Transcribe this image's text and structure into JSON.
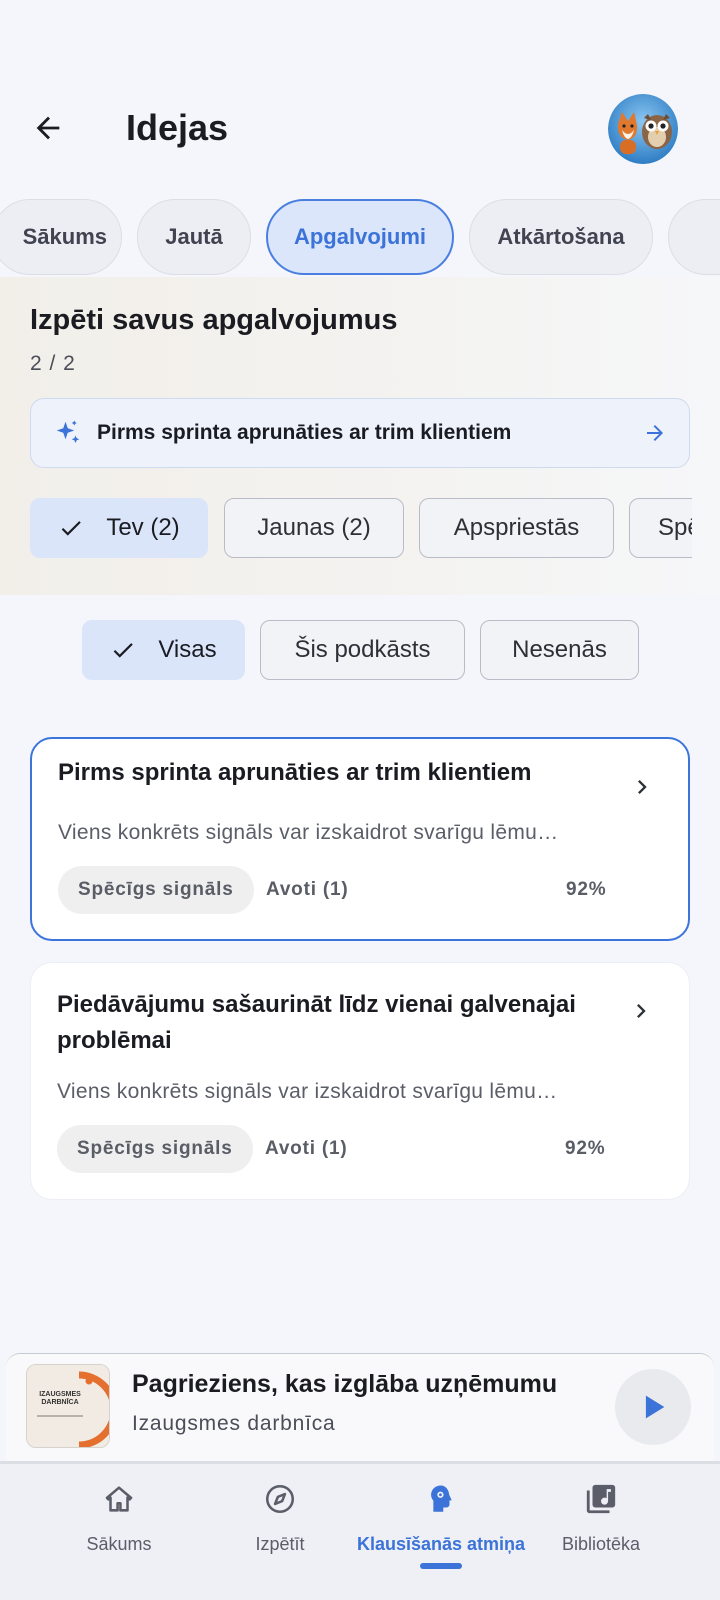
{
  "header": {
    "title": "Idejas"
  },
  "tabs": [
    {
      "label": "Sākums"
    },
    {
      "label": "Jautā"
    },
    {
      "label": "Apgalvojumi"
    },
    {
      "label": "Atkārtošana"
    }
  ],
  "section": {
    "title": "Izpēti savus apgalvojumus",
    "counter": "2 / 2"
  },
  "suggestion": {
    "text": "Pirms sprinta aprunāties ar trim klientiem"
  },
  "filters": [
    {
      "label": "Tev (2)"
    },
    {
      "label": "Jaunas (2)"
    },
    {
      "label": "Apspriestās"
    },
    {
      "label": "Spēcīgi"
    }
  ],
  "scopes": [
    {
      "label": "Visas"
    },
    {
      "label": "Šis podkāsts"
    },
    {
      "label": "Nesenās"
    }
  ],
  "cards": [
    {
      "title": "Pirms sprinta aprunāties ar trim klientiem",
      "description": "Viens konkrēts signāls var izskaidrot svarīgu lēmu…",
      "badge": "Spēcīgs signāls",
      "sources": "Avoti (1)",
      "confidence": "92%"
    },
    {
      "title": "Piedāvājumu sašaurināt līdz vienai galvenajai problēmai",
      "description": "Viens konkrēts signāls var izskaidrot svarīgu lēmu…",
      "badge": "Spēcīgs signāls",
      "sources": "Avoti (1)",
      "confidence": "92%"
    }
  ],
  "mini_player": {
    "title": "Pagrieziens, kas izglāba uzņēmumu",
    "subtitle": "Izaugsmes darbnīca",
    "cover_text": "IZAUGSMES DARBNĪCA"
  },
  "bottom_nav": [
    {
      "label": "Sākums",
      "icon": "home-icon"
    },
    {
      "label": "Izpētīt",
      "icon": "compass-icon"
    },
    {
      "label": "Klausīšanās atmiņa",
      "icon": "brain-icon"
    },
    {
      "label": "Bibliotēka",
      "icon": "library-icon"
    }
  ],
  "colors": {
    "accent": "#3b73d8",
    "background": "#f4f6fb",
    "card": "#ffffff"
  }
}
